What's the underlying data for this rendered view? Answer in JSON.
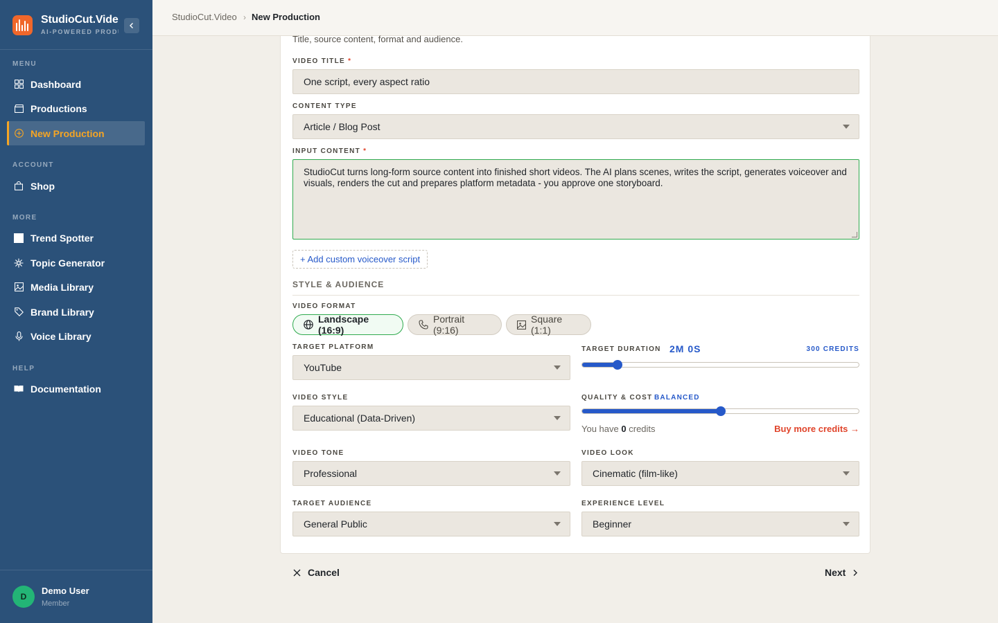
{
  "brand": {
    "title": "StudioCut.Video",
    "subtitle": "AI-POWERED PRODUCTION",
    "logo_color": "#f0672b"
  },
  "sidebar": {
    "sections": {
      "menu": "MENU",
      "account": "ACCOUNT",
      "more": "MORE",
      "help": "HELP"
    },
    "items": {
      "dashboard": "Dashboard",
      "productions": "Productions",
      "new_production": "New Production",
      "shop": "Shop",
      "trend_spotter": "Trend Spotter",
      "topic_generator": "Topic Generator",
      "media_library": "Media Library",
      "brand_library": "Brand Library",
      "voice_library": "Voice Library",
      "documentation": "Documentation"
    },
    "active_color": "#f5a524"
  },
  "user": {
    "initial": "D",
    "name": "Demo User",
    "role": "Member"
  },
  "breadcrumb": {
    "root": "StudioCut.Video",
    "separator": "›",
    "current": "New Production"
  },
  "form": {
    "intro": "Title, source content, format and audience.",
    "video_title": {
      "label": "VIDEO TITLE",
      "required": "*",
      "value": "One script, every aspect ratio"
    },
    "content_type": {
      "label": "CONTENT TYPE",
      "value": "Article / Blog Post"
    },
    "input_content": {
      "label": "INPUT CONTENT",
      "required": "*",
      "value": "StudioCut turns long-form source content into finished short videos. The AI plans scenes, writes the script, generates voiceover and visuals, renders the cut and prepares platform metadata - you approve one storyboard."
    },
    "add_script": "+ Add custom voiceover script",
    "style_section": "STYLE & AUDIENCE",
    "video_format": {
      "label": "VIDEO FORMAT",
      "options": {
        "landscape": "Landscape (16:9)",
        "portrait": "Portrait (9:16)",
        "square": "Square (1:1)"
      },
      "selected": "landscape"
    },
    "target_platform": {
      "label": "TARGET PLATFORM",
      "value": "YouTube"
    },
    "target_duration": {
      "label": "TARGET DURATION",
      "value": "2M 0S",
      "credits": "300 CREDITS",
      "slider_fraction": 0.13
    },
    "video_style": {
      "label": "VIDEO STYLE",
      "value": "Educational (Data-Driven)"
    },
    "quality_cost": {
      "label": "QUALITY & COST",
      "level": "BALANCED",
      "slider_fraction": 0.5
    },
    "credits_note": {
      "prefix": "You have",
      "count": "0",
      "suffix": "credits"
    },
    "buy_credits": "Buy more credits →",
    "video_tone": {
      "label": "VIDEO TONE",
      "value": "Professional"
    },
    "video_look": {
      "label": "VIDEO LOOK",
      "value": "Cinematic (film-like)"
    },
    "target_audience": {
      "label": "TARGET AUDIENCE",
      "value": "General Public"
    },
    "experience_level": {
      "label": "EXPERIENCE LEVEL",
      "value": "Beginner"
    }
  },
  "actions": {
    "cancel": "Cancel",
    "next": "Next"
  },
  "colors": {
    "accent_blue": "#2659c9",
    "focus_green": "#2faa4e",
    "danger": "#e0442b",
    "sidebar_bg": "#2b5179"
  }
}
